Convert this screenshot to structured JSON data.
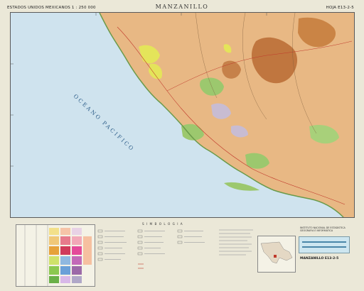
{
  "header": {
    "series_label": "ESTADOS UNIDOS MEXICANOS 1 : 250 000",
    "title": "MANZANILLO",
    "sheet_code": "HOJA E13-2-5"
  },
  "map": {
    "ocean_label": "OCEANO PACIFICO",
    "colors": {
      "ocean": "#cfe3ee",
      "land_base": "#e8b884",
      "dark_brown": "#b86a32",
      "yellow": "#e4e45a",
      "green": "#9cc86e",
      "lavender": "#c8bcd2"
    }
  },
  "legend": {
    "section_title": "S I M B O L O G I A"
  },
  "footer": {
    "institute_lines": [
      "INSTITUTO NACIONAL DE ESTADISTICA",
      "GEOGRAFIA E INFORMATICA"
    ],
    "hoja_label": "MANZANILLO E13-2-5",
    "handwritten_note": "",
    "stamp": ""
  }
}
